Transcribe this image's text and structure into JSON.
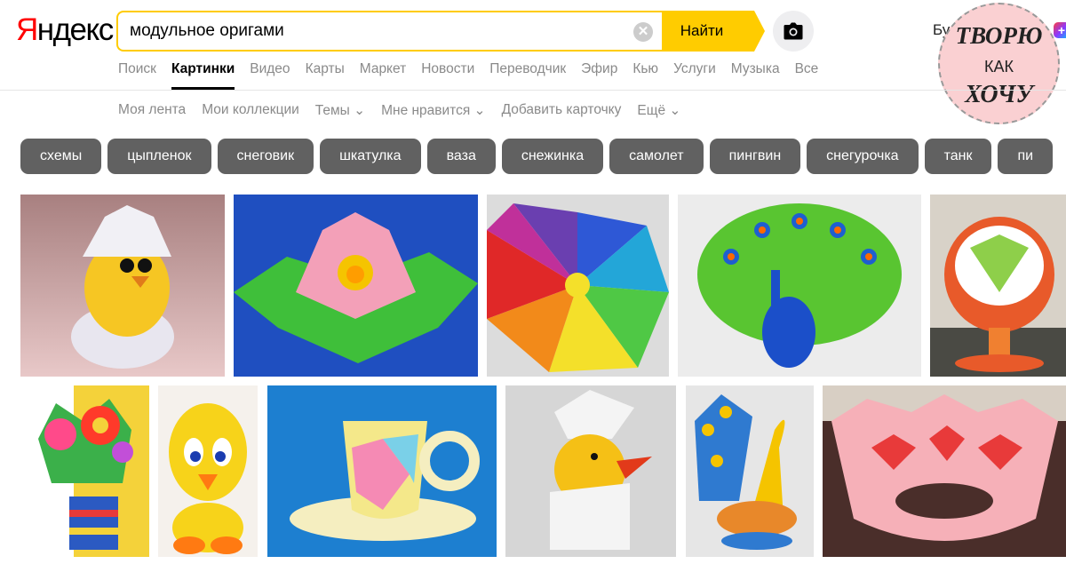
{
  "header": {
    "logo_first": "Я",
    "logo_rest": "ндекс",
    "search_value": "модульное оригами",
    "clear_symbol": "✕",
    "search_button": "Найти",
    "user_partial": "Бу"
  },
  "badge": {
    "line1": "ТВОРЮ",
    "line2": "КАК",
    "line3": "ХОЧУ"
  },
  "services": [
    "Поиск",
    "Картинки",
    "Видео",
    "Карты",
    "Маркет",
    "Новости",
    "Переводчик",
    "Эфир",
    "Кью",
    "Услуги",
    "Музыка",
    "Все"
  ],
  "active_service": "Картинки",
  "subnav": [
    "Моя лента",
    "Мои коллекции",
    "Темы ⌄",
    "Мне нравится ⌄",
    "Добавить карточку",
    "Ещё ⌄"
  ],
  "chips": [
    "схемы",
    "цыпленок",
    "снеговик",
    "шкатулка",
    "ваза",
    "снежинка",
    "самолет",
    "пингвин",
    "снегурочка",
    "танк",
    "пи"
  ],
  "colors": {
    "accent": "#ffcc00",
    "logo_red": "#ff0000",
    "chip_bg": "#616161"
  },
  "images": [
    {
      "name": "image-chick-in-egg",
      "subject": "chick-in-egg"
    },
    {
      "name": "image-lotus-flower",
      "subject": "lotus"
    },
    {
      "name": "image-rainbow-spiral",
      "subject": "rainbow-spiral"
    },
    {
      "name": "image-peacock-green",
      "subject": "peacock"
    },
    {
      "name": "image-vase-lamp",
      "subject": "vase"
    },
    {
      "name": "image-flower-vase",
      "subject": "flowers"
    },
    {
      "name": "image-yellow-bird",
      "subject": "tweety"
    },
    {
      "name": "image-cup-saucer",
      "subject": "cup"
    },
    {
      "name": "image-white-chick",
      "subject": "chick-white"
    },
    {
      "name": "image-peacock-swan",
      "subject": "peacock-swan"
    },
    {
      "name": "image-pink-bowl",
      "subject": "pink-bowl"
    }
  ]
}
